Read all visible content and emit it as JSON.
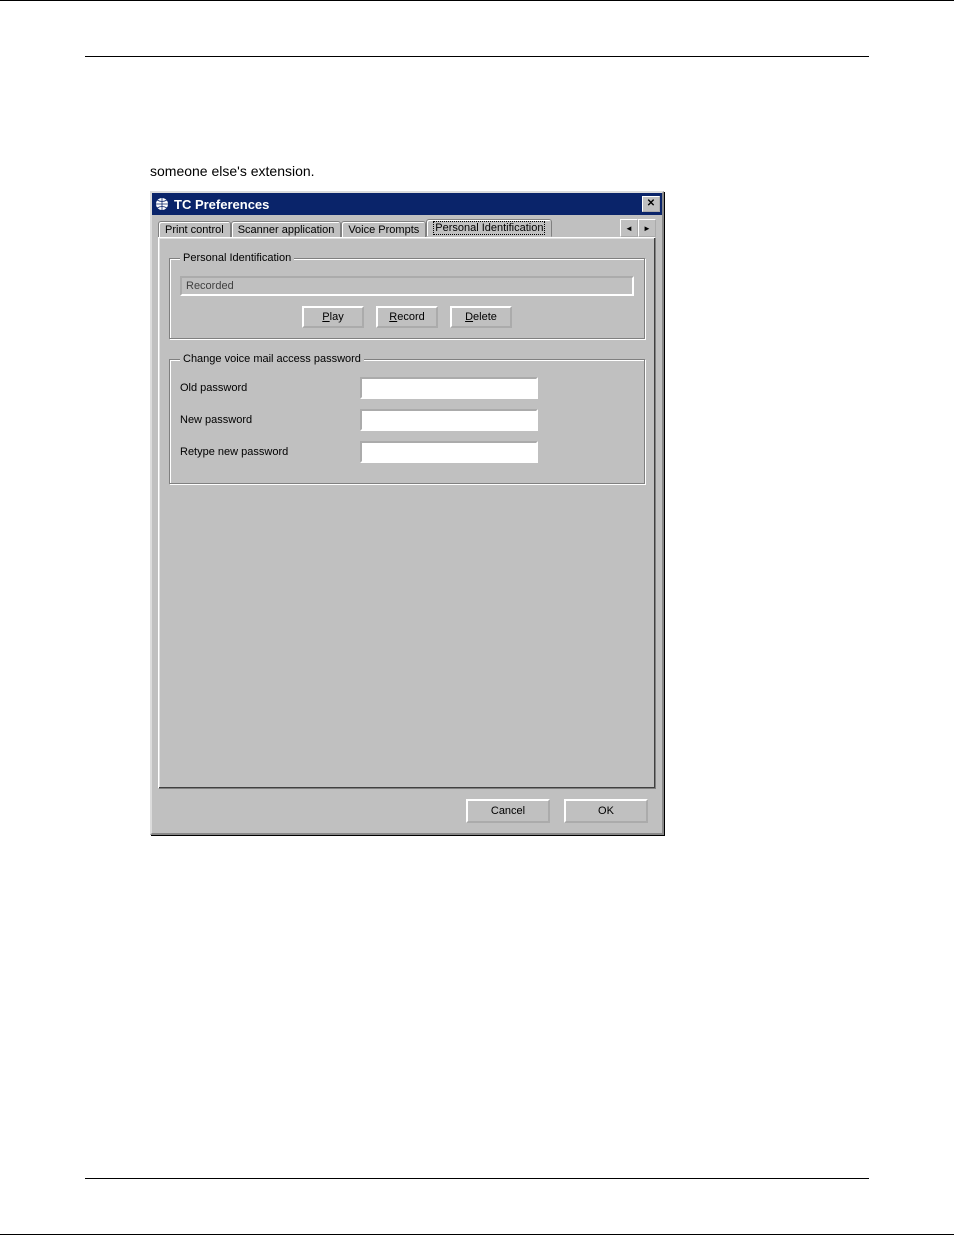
{
  "page": {
    "intro_text": "someone else's extension."
  },
  "dialog": {
    "title": "TC Preferences",
    "tabs": {
      "print_control": "Print control",
      "scanner_application": "Scanner application",
      "voice_prompts": "Voice Prompts",
      "personal_identification": "Personal Identification"
    },
    "arrows": {
      "left": "◄",
      "right": "►"
    },
    "close": "✕",
    "group_personal_identification": {
      "legend": "Personal Identification",
      "status_value": "Recorded",
      "buttons": {
        "play_pre": "P",
        "play_rest": "lay",
        "record_pre": "R",
        "record_rest": "ecord",
        "delete_pre": "D",
        "delete_rest": "elete"
      }
    },
    "group_password": {
      "legend": "Change voice mail access password",
      "old_label": "Old password",
      "new_label": "New password",
      "retype_label": "Retype new password",
      "old_value": "",
      "new_value": "",
      "retype_value": ""
    },
    "footer": {
      "cancel": "Cancel",
      "ok": "OK"
    }
  }
}
